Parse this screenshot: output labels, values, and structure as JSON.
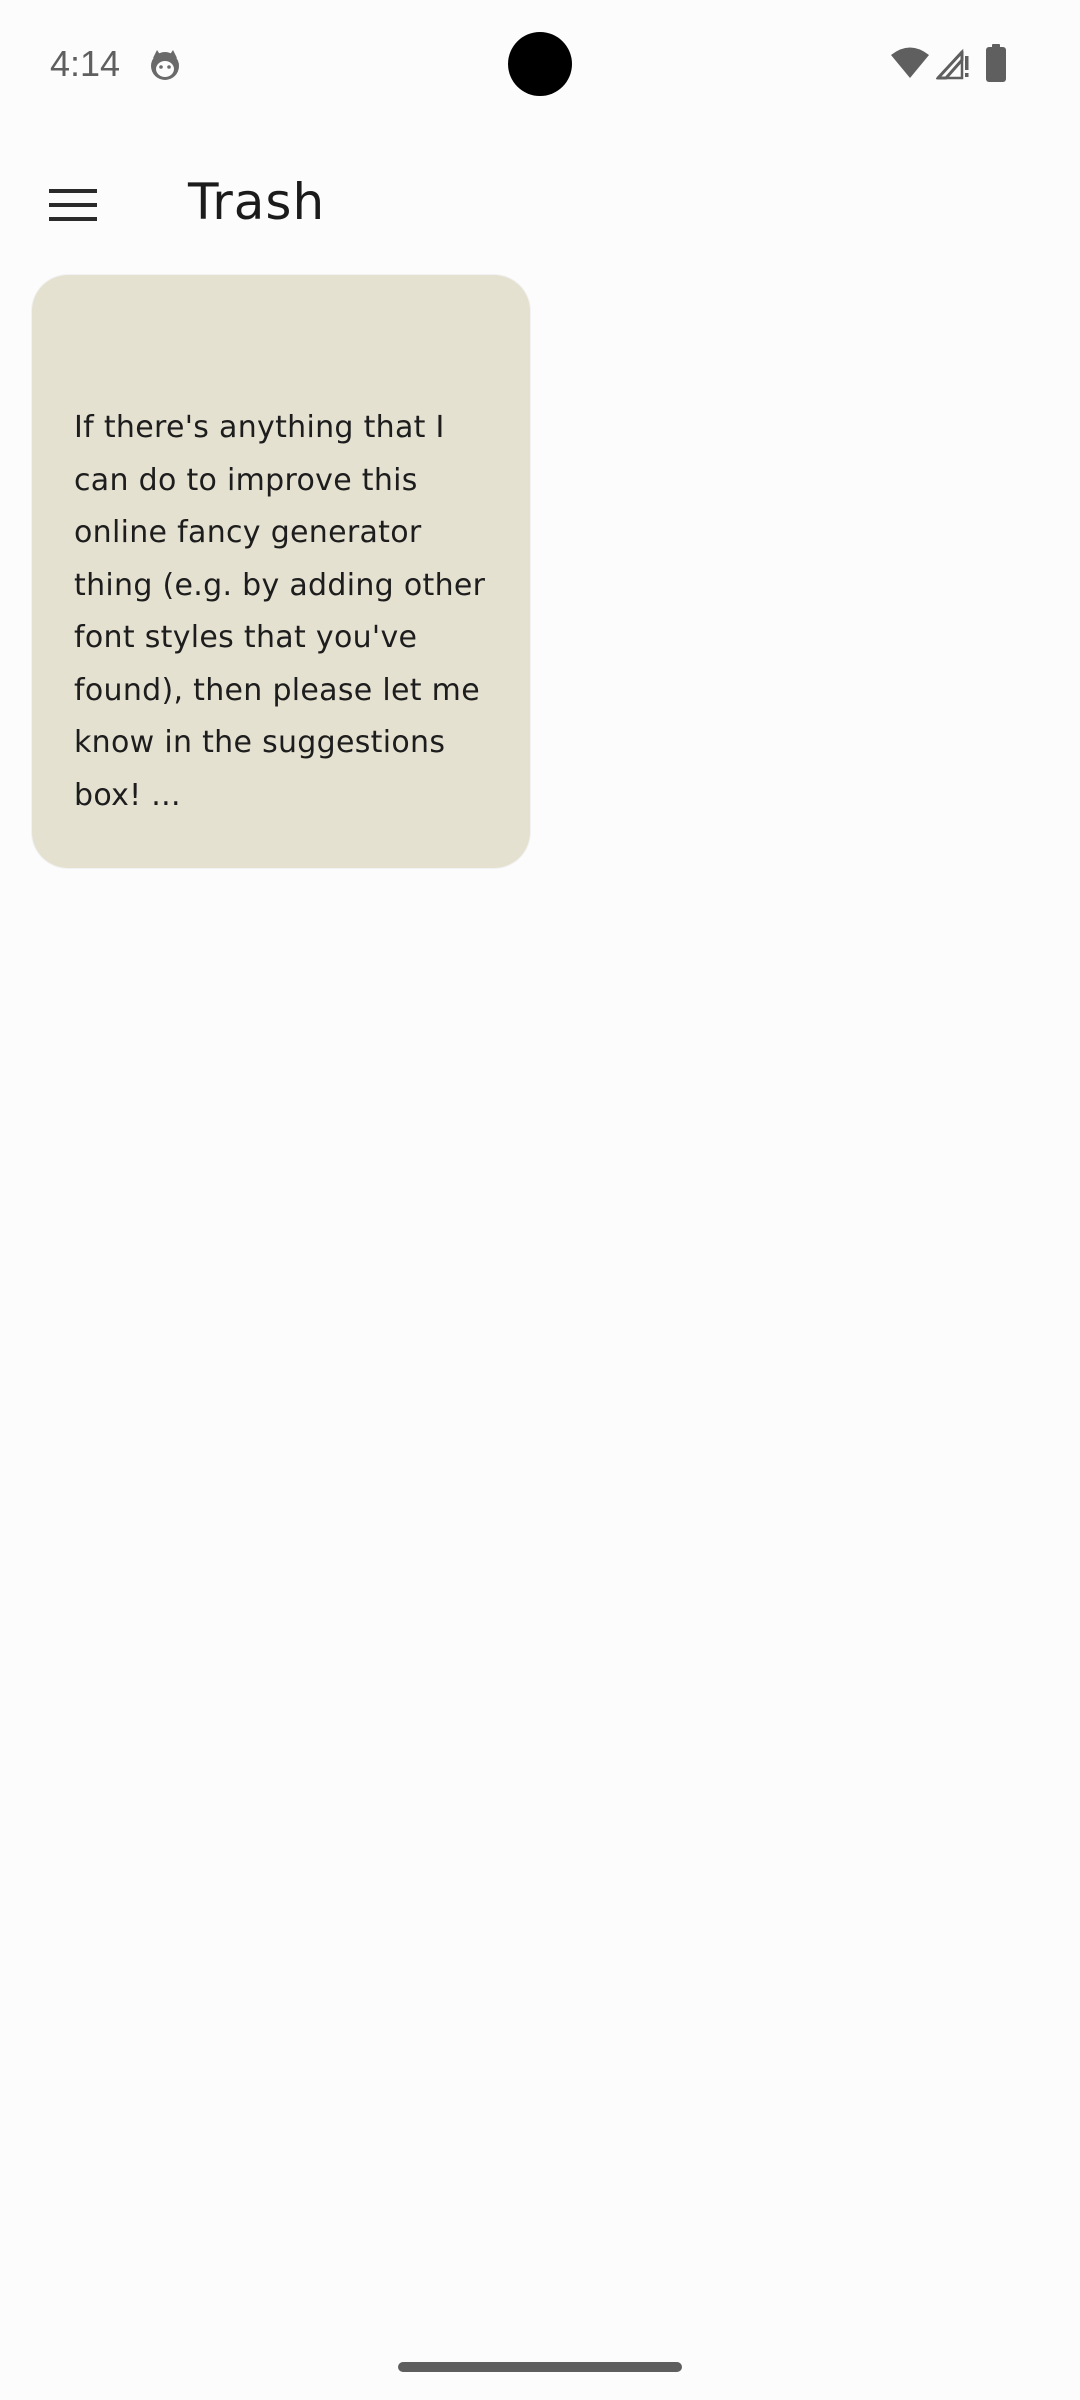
{
  "status_bar": {
    "time": "4:14",
    "notification_icon": "cat-face-icon",
    "wifi_icon": "wifi-icon",
    "signal_icon": "signal-no-data-icon",
    "battery_icon": "battery-icon"
  },
  "app_bar": {
    "menu_icon": "hamburger-menu-icon",
    "title": "Trash"
  },
  "notes": [
    {
      "body": "If there's anything that I can do to improve this online fancy generator thing (e.g. by adding other font styles that you've found), then please let me know in the suggestions box! ...",
      "background": "#e5e1d1"
    }
  ],
  "colors": {
    "background": "#fcfcfc",
    "card": "#e5e1d1",
    "text": "#1b1b1b",
    "status_icons": "#5f5f5f"
  }
}
